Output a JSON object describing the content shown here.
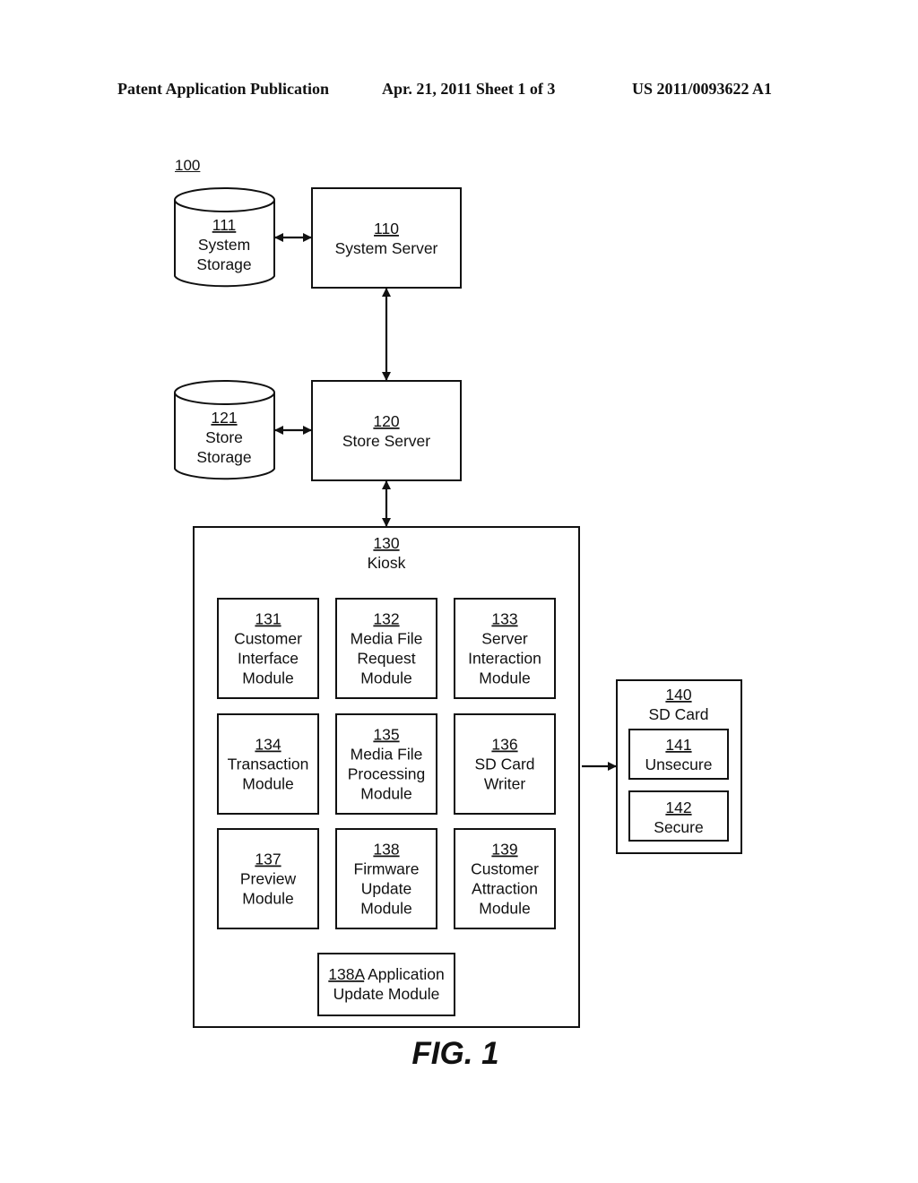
{
  "header": {
    "publication": "Patent Application Publication",
    "date_sheet": "Apr. 21, 2011  Sheet 1 of 3",
    "patent_number": "US 2011/0093622 A1"
  },
  "figure": {
    "system_ref": "100",
    "caption": "FIG. 1"
  },
  "nodes": {
    "system_storage": {
      "ref": "111",
      "lines": [
        "System",
        "Storage"
      ],
      "shape": "cylinder"
    },
    "system_server": {
      "ref": "110",
      "lines": [
        "System Server"
      ],
      "shape": "box"
    },
    "store_storage": {
      "ref": "121",
      "lines": [
        "Store",
        "Storage"
      ],
      "shape": "cylinder"
    },
    "store_server": {
      "ref": "120",
      "lines": [
        "Store Server"
      ],
      "shape": "box"
    },
    "kiosk": {
      "ref": "130",
      "lines": [
        "Kiosk"
      ],
      "shape": "container"
    },
    "sd_card": {
      "ref": "140",
      "lines": [
        "SD Card"
      ],
      "shape": "container"
    },
    "unsecure": {
      "ref": "141",
      "lines": [
        "Unsecure"
      ],
      "shape": "box"
    },
    "secure": {
      "ref": "142",
      "lines": [
        "Secure"
      ],
      "shape": "box"
    }
  },
  "kiosk_modules": [
    {
      "ref": "131",
      "lines": [
        "Customer",
        "Interface",
        "Module"
      ]
    },
    {
      "ref": "132",
      "lines": [
        "Media File",
        "Request",
        "Module"
      ]
    },
    {
      "ref": "133",
      "lines": [
        "Server",
        "Interaction",
        "Module"
      ]
    },
    {
      "ref": "134",
      "lines": [
        "Transaction",
        "Module"
      ]
    },
    {
      "ref": "135",
      "lines": [
        "Media File",
        "Processing",
        "Module"
      ]
    },
    {
      "ref": "136",
      "lines": [
        "SD Card",
        "Writer"
      ]
    },
    {
      "ref": "137",
      "lines": [
        "Preview",
        "Module"
      ]
    },
    {
      "ref": "138",
      "lines": [
        "Firmware",
        "Update",
        "Module"
      ]
    },
    {
      "ref": "139",
      "lines": [
        "Customer",
        "Attraction",
        "Module"
      ]
    }
  ],
  "app_update_module": {
    "ref": "138A",
    "line1_rest": "Application",
    "line2": "Update Module"
  },
  "connections": [
    {
      "from": "system_storage",
      "to": "system_server",
      "direction": "bidirectional"
    },
    {
      "from": "system_server",
      "to": "store_server",
      "direction": "bidirectional"
    },
    {
      "from": "store_storage",
      "to": "store_server",
      "direction": "bidirectional"
    },
    {
      "from": "store_server",
      "to": "kiosk",
      "direction": "bidirectional"
    },
    {
      "from": "kiosk",
      "to": "sd_card",
      "direction": "unidirectional"
    }
  ]
}
